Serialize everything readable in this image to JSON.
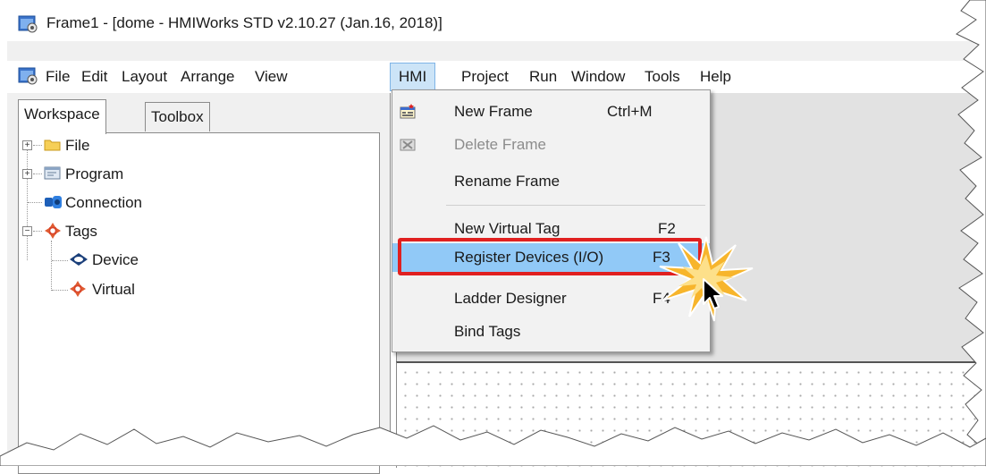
{
  "window": {
    "title": "Frame1 - [dome - HMIWorks STD v2.10.27 (Jan.16, 2018)]"
  },
  "menubar": {
    "items": [
      "File",
      "Edit",
      "Layout",
      "Arrange",
      "View",
      "HMI",
      "Project",
      "Run",
      "Window",
      "Tools",
      "Help"
    ],
    "open_item": "HMI"
  },
  "left_panel": {
    "tabs": [
      "Workspace",
      "Toolbox"
    ],
    "active_tab": "Workspace",
    "tree": [
      {
        "label": "File",
        "icon": "folder-icon",
        "expander": "+"
      },
      {
        "label": "Program",
        "icon": "program-icon",
        "expander": "+"
      },
      {
        "label": "Connection",
        "icon": "connection-icon",
        "expander": ""
      },
      {
        "label": "Tags",
        "icon": "tags-icon",
        "expander": "-"
      },
      {
        "label": "Device",
        "icon": "device-icon",
        "expander": ""
      },
      {
        "label": "Virtual",
        "icon": "virtual-tag-icon",
        "expander": ""
      }
    ]
  },
  "hmi_menu": {
    "items": [
      {
        "label": "New Frame",
        "shortcut": "Ctrl+M",
        "icon": "new-frame-icon",
        "enabled": true
      },
      {
        "label": "Delete Frame",
        "shortcut": "",
        "icon": "delete-frame-icon",
        "enabled": false
      },
      {
        "label": "Rename Frame",
        "shortcut": "",
        "icon": "",
        "enabled": true
      },
      {
        "label": "New Virtual Tag",
        "shortcut": "F2",
        "icon": "",
        "enabled": true
      },
      {
        "label": "Register Devices (I/O)",
        "shortcut": "F3",
        "icon": "",
        "enabled": true,
        "highlighted": true
      },
      {
        "label": "Ladder Designer",
        "shortcut": "F4",
        "icon": "",
        "enabled": true
      },
      {
        "label": "Bind Tags",
        "shortcut": "",
        "icon": "",
        "enabled": true
      }
    ]
  },
  "colors": {
    "highlight": "#91c9f7",
    "callout_border": "#e02020",
    "burst": "#f7b52c"
  }
}
